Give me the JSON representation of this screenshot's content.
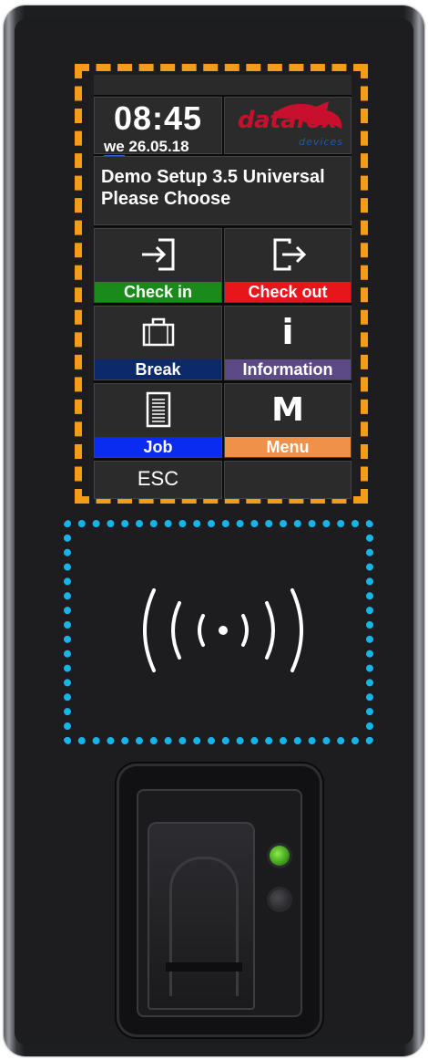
{
  "screen": {
    "time": "08:45",
    "day_of_week": "we",
    "date": "26.05.18",
    "logo": {
      "brand": "datafox",
      "sub": "devices"
    },
    "status_line_1": "Demo Setup 3.5 Universal",
    "status_line_2": "Please Choose",
    "buttons": {
      "check_in": {
        "label": "Check in",
        "color": "#1a8a1a"
      },
      "check_out": {
        "label": "Check out",
        "color": "#e8151b"
      },
      "break": {
        "label": "Break",
        "color": "#0c2a6b"
      },
      "information": {
        "label": "Information",
        "color": "#5c4a86",
        "icon_text": "i"
      },
      "job": {
        "label": "Job",
        "color": "#0a2cf0"
      },
      "menu": {
        "label": "Menu",
        "color": "#f0914a",
        "icon_text": "M"
      },
      "esc": {
        "label": "ESC"
      }
    }
  },
  "icons": {
    "check_in": "sign-in-icon",
    "check_out": "sign-out-icon",
    "break": "briefcase-icon",
    "job": "document-icon",
    "rfid": "contactless-icon",
    "fingerprint": "fingerprint-sensor-icon"
  },
  "highlight_colors": {
    "screen_outline": "#f39c1a",
    "rfid_outline": "#16b4ea"
  }
}
